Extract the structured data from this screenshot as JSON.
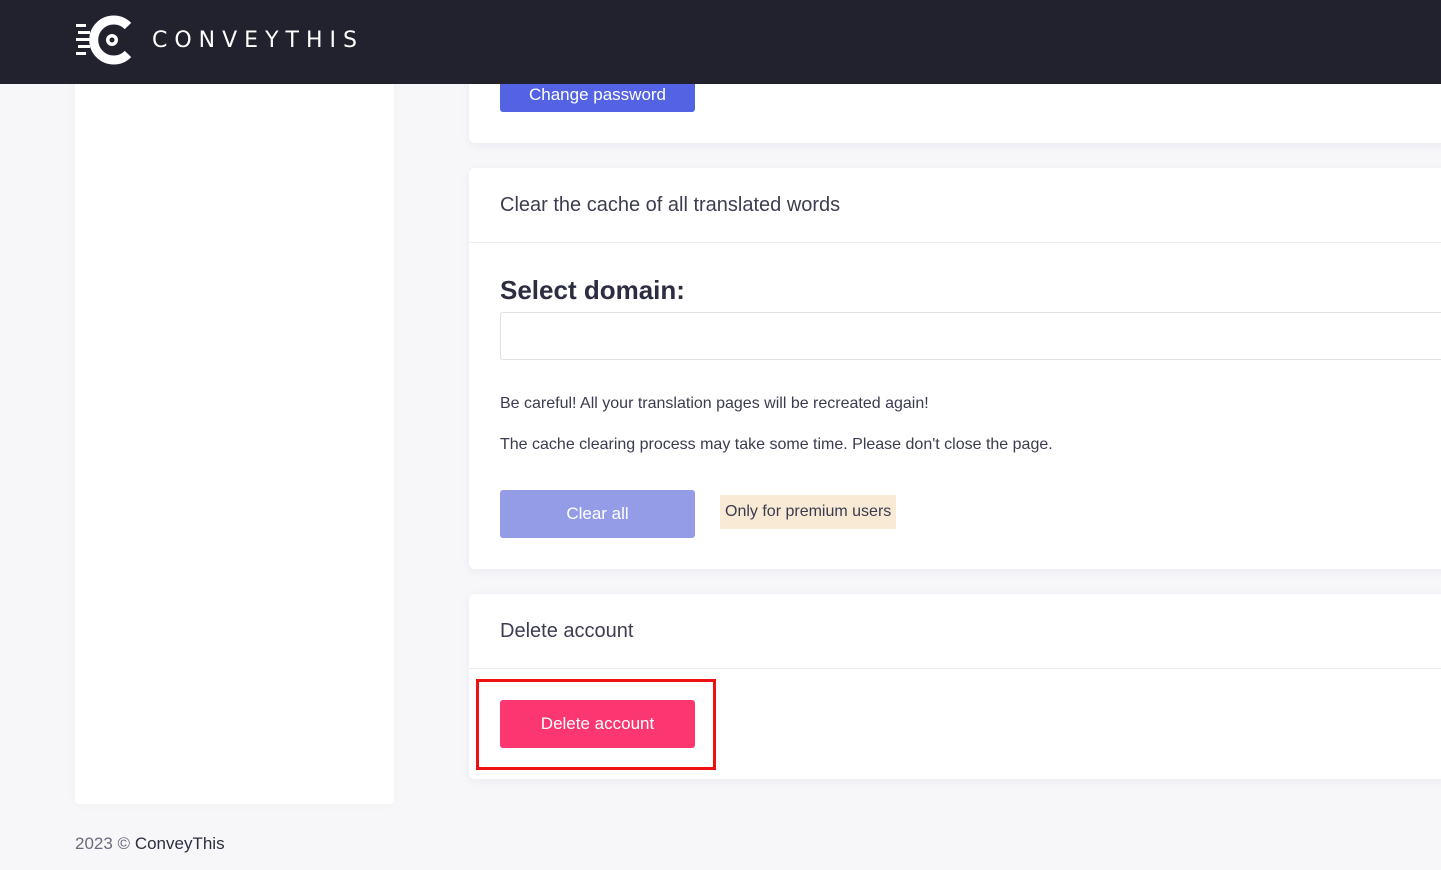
{
  "header": {
    "logo_text": "CONVEYTHIS",
    "logo_icon": "conveythis-logo-icon",
    "background": "#22222f"
  },
  "password_card": {
    "change_password_label": "Change password",
    "button_color": "#5462e4"
  },
  "cache_card": {
    "title": "Clear the cache of all translated words",
    "select_label": "Select domain:",
    "select_value": "",
    "warning_1": "Be careful! All your translation pages will be recreated again!",
    "warning_2": "The cache clearing process may take some time. Please don't close the page.",
    "clear_all_label": "Clear all",
    "premium_badge": "Only for premium users",
    "button_color": "#949ce8"
  },
  "delete_card": {
    "title": "Delete account",
    "delete_label": "Delete account",
    "button_color": "#fc3671",
    "highlight_color": "#ee1111"
  },
  "footer": {
    "copyright": "2023 ©",
    "brand": "ConveyThis"
  }
}
